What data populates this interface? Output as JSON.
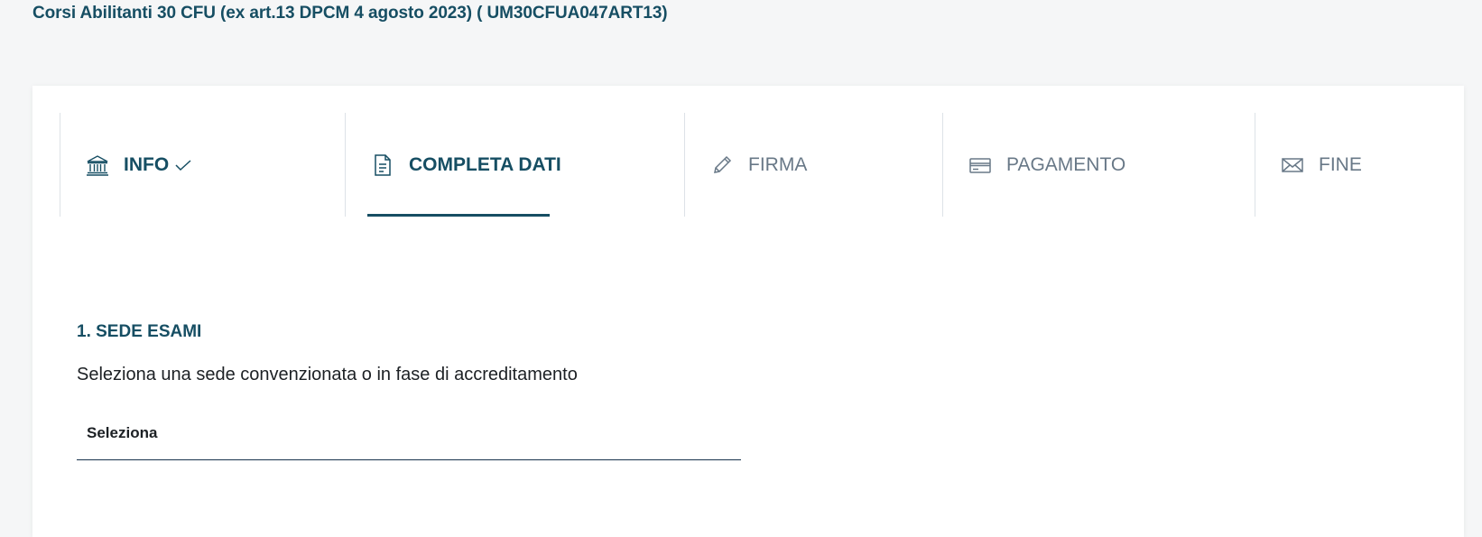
{
  "header": {
    "course_title": "Corsi Abilitanti 30 CFU (ex art.13 DPCM 4 agosto 2023) ( UM30CFUA047ART13)"
  },
  "stepper": {
    "steps": [
      {
        "label": "INFO",
        "icon": "bank-icon",
        "status": "done"
      },
      {
        "label": "COMPLETA DATI",
        "icon": "document-icon",
        "status": "active"
      },
      {
        "label": "FIRMA",
        "icon": "pencil-icon",
        "status": "pending"
      },
      {
        "label": "PAGAMENTO",
        "icon": "credit-card-icon",
        "status": "pending"
      },
      {
        "label": "FINE",
        "icon": "envelope-icon",
        "status": "pending"
      }
    ],
    "colors": {
      "active": "#164e63",
      "pending": "#687887",
      "divider": "#dde2e7"
    }
  },
  "section": {
    "title": "1. SEDE ESAMI",
    "description": "Seleziona una sede convenzionata o in fase di accreditamento",
    "select": {
      "placeholder": "Seleziona"
    }
  }
}
